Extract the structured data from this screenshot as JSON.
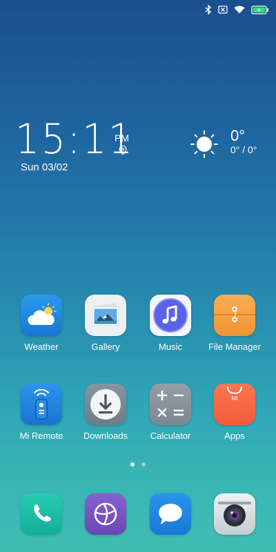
{
  "status_bar": {
    "icons": [
      "bluetooth-icon",
      "no-sim-icon",
      "wifi-icon",
      "battery-charging-icon"
    ]
  },
  "clock": {
    "time": "15:11",
    "ampm": "PM",
    "date": "Sun 03/02",
    "location_icon": "location-pin-icon"
  },
  "weather_widget": {
    "icon": "sun-icon",
    "temp": "0°",
    "range": "0° / 0°"
  },
  "apps_row1": [
    {
      "label": "Weather",
      "icon": "weather-app-icon",
      "color": "#1e88e5"
    },
    {
      "label": "Gallery",
      "icon": "gallery-app-icon",
      "color": "#eceff1"
    },
    {
      "label": "Music",
      "icon": "music-app-icon",
      "color": "#ffffff"
    },
    {
      "label": "File Manager",
      "icon": "file-manager-app-icon",
      "color": "#f5a248"
    }
  ],
  "apps_row2": [
    {
      "label": "Mi Remote",
      "icon": "mi-remote-app-icon",
      "color": "#1e88e5"
    },
    {
      "label": "Downloads",
      "icon": "downloads-app-icon",
      "color": "#78909c"
    },
    {
      "label": "Calculator",
      "icon": "calculator-app-icon",
      "color": "#8b97a0"
    },
    {
      "label": "Apps",
      "icon": "apps-store-icon",
      "color": "#f96846"
    }
  ],
  "page_indicator": {
    "pages": 2,
    "active": 1
  },
  "dock": [
    {
      "icon": "phone-app-icon",
      "color": "#1fbfa7"
    },
    {
      "icon": "browser-app-icon",
      "color": "#7a56c2"
    },
    {
      "icon": "messaging-app-icon",
      "color": "#1e88e5"
    },
    {
      "icon": "camera-app-icon",
      "color": "#cfd8dc"
    }
  ]
}
